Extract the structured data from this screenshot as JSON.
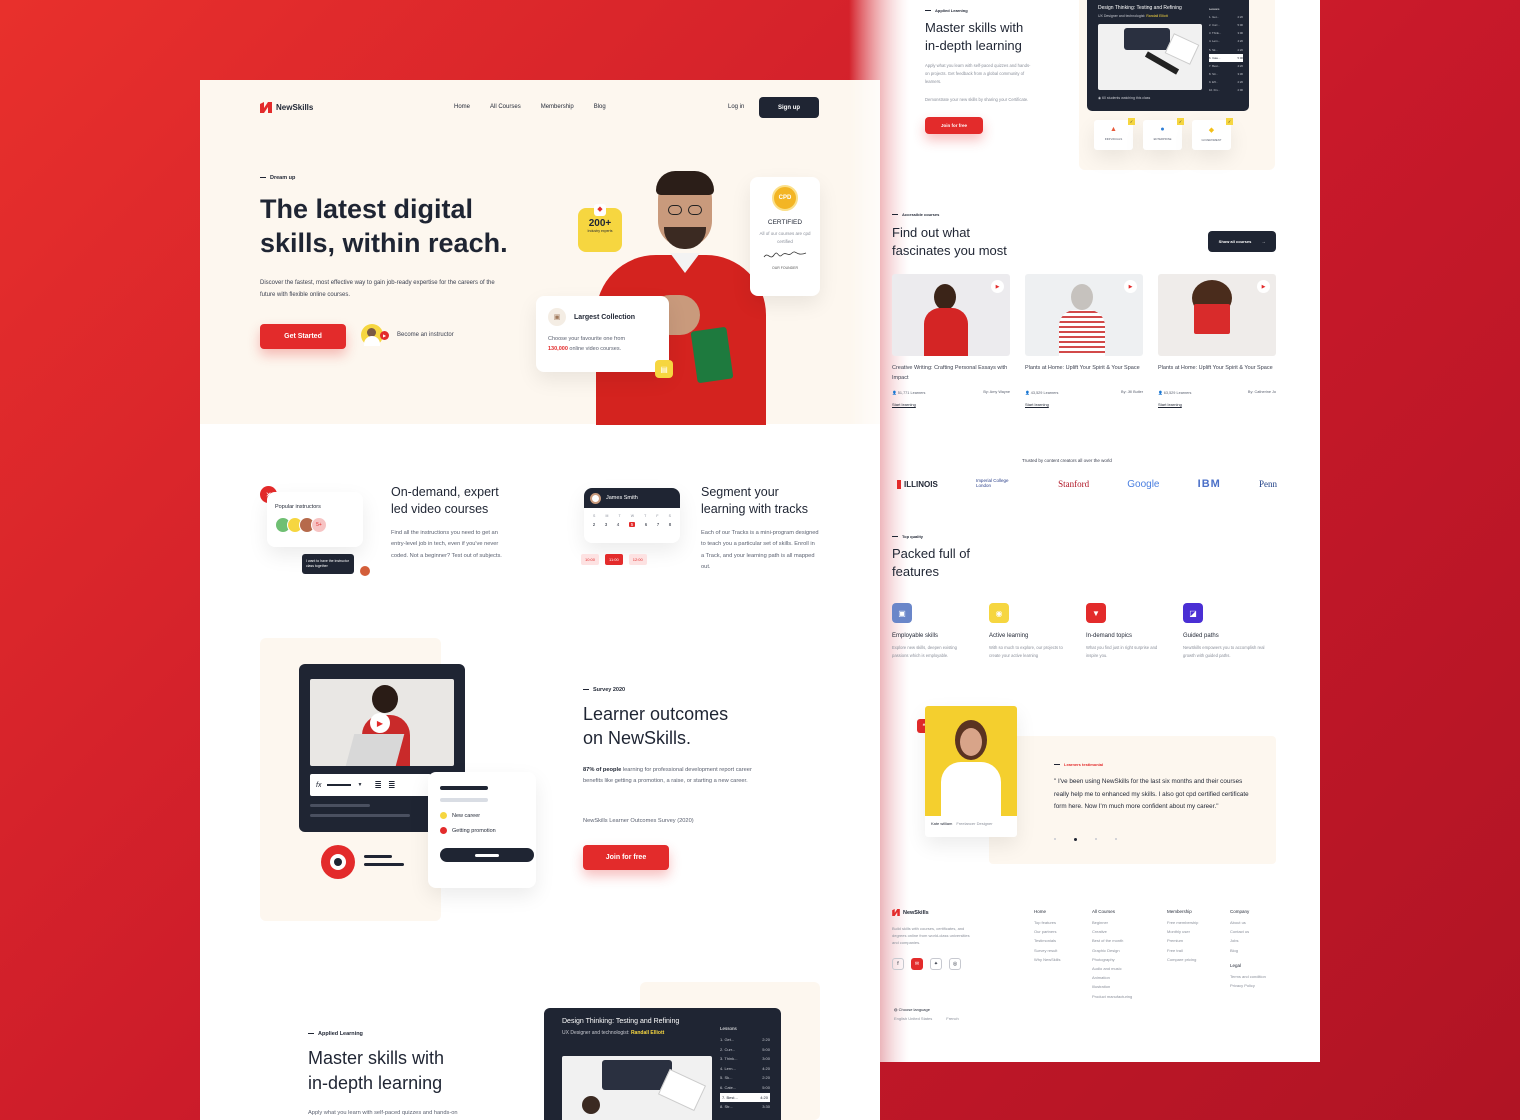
{
  "brand": {
    "name": "NewSkills"
  },
  "nav": {
    "home": "Home",
    "courses": "All Courses",
    "membership": "Membership",
    "blog": "Blog",
    "login": "Log in",
    "signup": "Sign up"
  },
  "hero": {
    "eyebrow": "Dream up",
    "title_line1": "The latest digital",
    "title_line2": "skills, within reach.",
    "body": "Discover the fastest, most effective way to gain job-ready expertise for the careers of the future with flexible online courses.",
    "cta": "Get Started",
    "instructor": "Become an instructor",
    "badge_count": "200+",
    "badge_label": "Industry experts",
    "certified_title": "CERTIFIED",
    "certified_body": "All of our courses are cpd certified",
    "certified_sign": "OUR FOUNDER",
    "cpd": "CPD",
    "collection_title": "Largest Collection",
    "collection_body_pre": "Choose your favourite one from",
    "collection_count": "130,000",
    "collection_body_post": "online video courses."
  },
  "features": {
    "f1": {
      "title_line1": "On-demand, expert",
      "title_line2": "led video courses",
      "body": "Find all the instructions you need to get an entry-level job in tech, even if you've never coded. Not a beginner? Test out of subjects.",
      "card_label": "Popular instructors",
      "count": "5+",
      "chat": "I want to have the instructor class together"
    },
    "f2": {
      "title_line1": "Segment your",
      "title_line2": "learning with tracks",
      "body": "Each of our Tracks is a mini-program designed to teach you a particular set of skills. Enroll in a Track, and your learning path is all mapped out.",
      "user": "James Smith",
      "days": [
        "S",
        "M",
        "T",
        "W",
        "T",
        "F",
        "S"
      ],
      "dates": [
        "2",
        "3",
        "4",
        "5",
        "6",
        "7",
        "8"
      ],
      "times": [
        "10:00",
        "11:00",
        "12:00"
      ]
    }
  },
  "outcomes": {
    "eyebrow": "Survey 2020",
    "title_line1": "Learner outcomes",
    "title_line2": "on NewSkills.",
    "body_bold": "87% of people",
    "body": "learning for professional development report career benefits like getting a promotion, a raise, or starting a new career.",
    "source": "NewSkills Learner Outcomes Survey (2020)",
    "cta": "Join for free",
    "legend1": "New career",
    "legend2": "Getting promotion",
    "fx": "fx"
  },
  "applied": {
    "eyebrow": "Applied Learning",
    "title_line1": "Master skills with",
    "title_line2": "in-depth learning",
    "body": "Apply what you learn with self-paced quizzes and hands-on projects. Get feedback from a global community of learners.",
    "body2": "Demonstrate your new skills by sharing your Certificate.",
    "cta": "Join for free",
    "video_title": "Design Thinking: Testing and Refining",
    "video_sub": "UX Designer and technologist:",
    "video_author": "Randall Elliott",
    "lessons_label": "Lessons",
    "lessons": [
      {
        "n": "1. Get...",
        "t": "2:20"
      },
      {
        "n": "2. Curr...",
        "t": "5:00"
      },
      {
        "n": "3. Think...",
        "t": "3:00"
      },
      {
        "n": "4. Lern...",
        "t": "4:20"
      },
      {
        "n": "5. Sk...",
        "t": "2:20"
      },
      {
        "n": "6. Cate...",
        "t": "5:00"
      },
      {
        "n": "7. Best...",
        "t": "4:20"
      },
      {
        "n": "8. Str...",
        "t": "3:30"
      },
      {
        "n": "9. Eff...",
        "t": "2:20"
      },
      {
        "n": "10. Fin...",
        "t": "2:00"
      }
    ],
    "watching": "60 students watching this class",
    "icons": [
      "INDIVIDUALS",
      "ENTERPRISE",
      "GOVERNMENT"
    ]
  },
  "courses": {
    "eyebrow": "Accessible courses",
    "title_line1": "Find out what",
    "title_line2": "fascinates you most",
    "cta": "Show all courses",
    "items": [
      {
        "title": "Creative Writing: Crafting Personal Essays with Impact",
        "learners": "51,771 Learners",
        "by": "By: Amy Wayne",
        "link": "Start learning"
      },
      {
        "title": "Plants at Home: Uplift Your Spirit & Your Space",
        "learners": "43,529 Learners",
        "by": "By: Jill Butler",
        "link": "Start learning"
      },
      {
        "title": "Plants at Home: Uplift Your Spirit & Your Space",
        "learners": "63,529 Learners",
        "by": "By: Catherine Jo",
        "link": "Start learning"
      }
    ]
  },
  "trusted": {
    "label": "Trusted by content creators all over the world",
    "logos": [
      "ILLINOIS",
      "Imperial College London",
      "Stanford",
      "Google",
      "IBM",
      "Penn"
    ]
  },
  "packed": {
    "eyebrow": "Top quality",
    "title_line1": "Packed full of",
    "title_line2": "features",
    "items": [
      {
        "title": "Employable skills",
        "body": "Explore new skills, deepen existing passions which is employable."
      },
      {
        "title": "Active learning",
        "body": "With so much to explore, our projects to create your active learning"
      },
      {
        "title": "In-demand topics",
        "body": "What you find just in right surprise and inspire you."
      },
      {
        "title": "Guided paths",
        "body": "NewSkills empowers you to accomplish real growth with guided paths."
      }
    ]
  },
  "testimonial": {
    "eyebrow": "Learners testimonial",
    "quote": "\" I've been using NewSkills for the last six months and their courses really help me to enhanced my skills. I also got cpd certified certificate form here. Now I'm much more confident about my career.\"",
    "name": "Kate william",
    "role": "Freelancer Designer"
  },
  "footer": {
    "about": "Build skills with courses, certificates, and degrees online from world-class universities and companies.",
    "lang_label": "Choose language",
    "langs": [
      "English United States",
      "French"
    ],
    "cols": [
      {
        "h": "Home",
        "items": [
          "Top features",
          "Our partners",
          "Testimonials",
          "Survey result",
          "Why NewSkills"
        ]
      },
      {
        "h": "All Courses",
        "items": [
          "Beginner",
          "Creative",
          "Best of the month",
          "Graphic Design",
          "Photography",
          "Audio and music",
          "Animation",
          "Illustration",
          "Product manufacturing"
        ]
      },
      {
        "h": "Membership",
        "items": [
          "Free membership",
          "Monthly user",
          "Premium",
          "Free trail",
          "Compare pricing"
        ]
      },
      {
        "h": "Company",
        "items": [
          "About us",
          "Contact us",
          "Jobs",
          "Blog"
        ]
      }
    ],
    "legal_h": "Legal",
    "legal": [
      "Terms and condition",
      "Privacy Policy"
    ]
  },
  "colors": {
    "accent": "#e32b2b",
    "dark": "#1f2533",
    "cream": "#fdf7ef",
    "yellow": "#f6d640",
    "purple": "#4a2fd4"
  }
}
